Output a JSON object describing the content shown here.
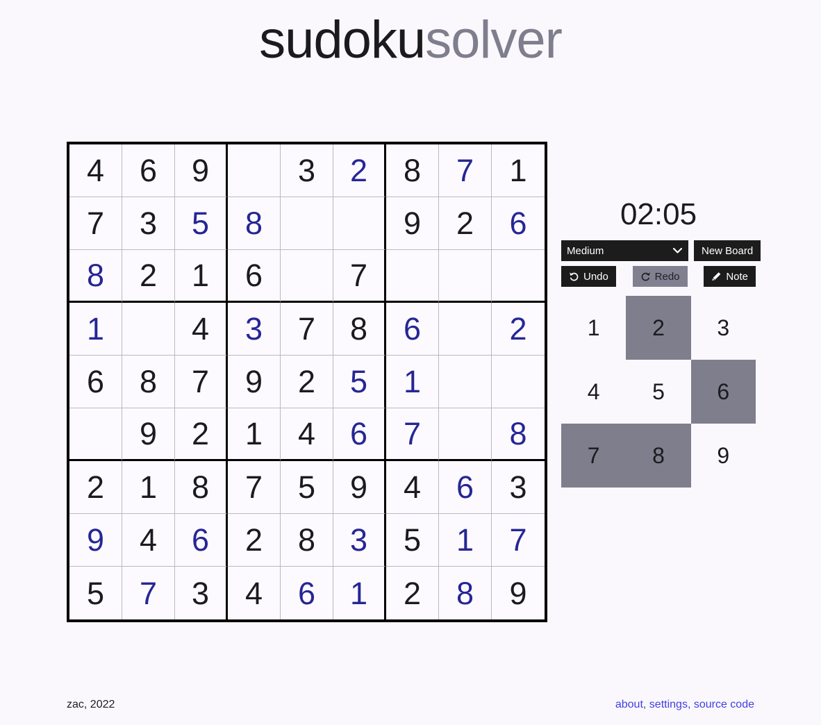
{
  "header": {
    "title_main": "sudoku",
    "title_sub": "solver"
  },
  "board": {
    "rows": [
      [
        {
          "v": "4",
          "user": false
        },
        {
          "v": "6",
          "user": false
        },
        {
          "v": "9",
          "user": false
        },
        {
          "v": "",
          "user": false
        },
        {
          "v": "3",
          "user": false
        },
        {
          "v": "2",
          "user": true
        },
        {
          "v": "8",
          "user": false
        },
        {
          "v": "7",
          "user": true
        },
        {
          "v": "1",
          "user": false
        }
      ],
      [
        {
          "v": "7",
          "user": false
        },
        {
          "v": "3",
          "user": false
        },
        {
          "v": "5",
          "user": true
        },
        {
          "v": "8",
          "user": true
        },
        {
          "v": "",
          "user": false
        },
        {
          "v": "",
          "user": false
        },
        {
          "v": "9",
          "user": false
        },
        {
          "v": "2",
          "user": false
        },
        {
          "v": "6",
          "user": true
        }
      ],
      [
        {
          "v": "8",
          "user": true
        },
        {
          "v": "2",
          "user": false
        },
        {
          "v": "1",
          "user": false
        },
        {
          "v": "6",
          "user": false
        },
        {
          "v": "",
          "user": false
        },
        {
          "v": "7",
          "user": false
        },
        {
          "v": "",
          "user": false
        },
        {
          "v": "",
          "user": false
        },
        {
          "v": "",
          "user": false
        }
      ],
      [
        {
          "v": "1",
          "user": true
        },
        {
          "v": "",
          "user": false
        },
        {
          "v": "4",
          "user": false
        },
        {
          "v": "3",
          "user": true
        },
        {
          "v": "7",
          "user": false
        },
        {
          "v": "8",
          "user": false
        },
        {
          "v": "6",
          "user": true
        },
        {
          "v": "",
          "user": false
        },
        {
          "v": "2",
          "user": true
        }
      ],
      [
        {
          "v": "6",
          "user": false
        },
        {
          "v": "8",
          "user": false
        },
        {
          "v": "7",
          "user": false
        },
        {
          "v": "9",
          "user": false
        },
        {
          "v": "2",
          "user": false
        },
        {
          "v": "5",
          "user": true
        },
        {
          "v": "1",
          "user": true
        },
        {
          "v": "",
          "user": false
        },
        {
          "v": "",
          "user": false
        }
      ],
      [
        {
          "v": "",
          "user": false
        },
        {
          "v": "9",
          "user": false
        },
        {
          "v": "2",
          "user": false
        },
        {
          "v": "1",
          "user": false
        },
        {
          "v": "4",
          "user": false
        },
        {
          "v": "6",
          "user": true
        },
        {
          "v": "7",
          "user": true
        },
        {
          "v": "",
          "user": false
        },
        {
          "v": "8",
          "user": true
        }
      ],
      [
        {
          "v": "2",
          "user": false
        },
        {
          "v": "1",
          "user": false
        },
        {
          "v": "8",
          "user": false
        },
        {
          "v": "7",
          "user": false
        },
        {
          "v": "5",
          "user": false
        },
        {
          "v": "9",
          "user": false
        },
        {
          "v": "4",
          "user": false
        },
        {
          "v": "6",
          "user": true
        },
        {
          "v": "3",
          "user": false
        }
      ],
      [
        {
          "v": "9",
          "user": true
        },
        {
          "v": "4",
          "user": false
        },
        {
          "v": "6",
          "user": true
        },
        {
          "v": "2",
          "user": false
        },
        {
          "v": "8",
          "user": false
        },
        {
          "v": "3",
          "user": true
        },
        {
          "v": "5",
          "user": false
        },
        {
          "v": "1",
          "user": true
        },
        {
          "v": "7",
          "user": true
        }
      ],
      [
        {
          "v": "5",
          "user": false
        },
        {
          "v": "7",
          "user": true
        },
        {
          "v": "3",
          "user": false
        },
        {
          "v": "4",
          "user": false
        },
        {
          "v": "6",
          "user": true
        },
        {
          "v": "1",
          "user": true
        },
        {
          "v": "2",
          "user": false
        },
        {
          "v": "8",
          "user": true
        },
        {
          "v": "9",
          "user": false
        }
      ]
    ]
  },
  "panel": {
    "timer": "02:05",
    "difficulty": {
      "selected": "Medium",
      "options": [
        "Medium"
      ],
      "chevron": "chevron-down-icon"
    },
    "new_board_label": "New Board",
    "undo_label": "Undo",
    "redo_label": "Redo",
    "note_label": "Note",
    "redo_disabled": true,
    "numpad": [
      {
        "label": "1",
        "filled": false
      },
      {
        "label": "2",
        "filled": true
      },
      {
        "label": "3",
        "filled": false
      },
      {
        "label": "4",
        "filled": false
      },
      {
        "label": "5",
        "filled": false
      },
      {
        "label": "6",
        "filled": true
      },
      {
        "label": "7",
        "filled": true
      },
      {
        "label": "8",
        "filled": true
      },
      {
        "label": "9",
        "filled": false
      }
    ]
  },
  "footer": {
    "credit": "zac, 2022",
    "links": [
      "about",
      "settings",
      "source code"
    ],
    "separator": ", "
  },
  "colors": {
    "background": "#faf8fd",
    "cell_background": "#fcfaff",
    "given_digit": "#1b1b1f",
    "user_digit": "#262695",
    "grid_line": "#b9b9c6",
    "grid_border": "#000000",
    "button_bg": "#1c1c1c",
    "button_text": "#ffffff",
    "disabled_bg": "#808091",
    "numpad_filled": "#7e7e8c",
    "link": "#4040e0",
    "title_sub": "#7e7e8c"
  }
}
